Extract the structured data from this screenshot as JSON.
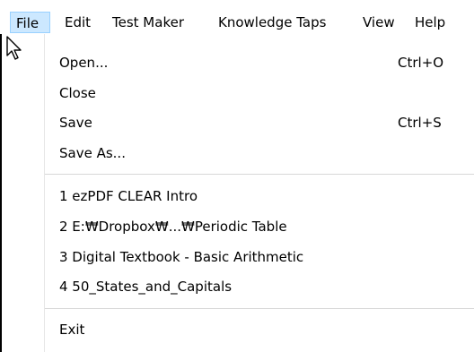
{
  "menubar": {
    "items": [
      {
        "label": "File"
      },
      {
        "label": "Edit"
      },
      {
        "label": "Test Maker"
      },
      {
        "label": "Knowledge Taps"
      },
      {
        "label": "View"
      },
      {
        "label": "Help"
      }
    ]
  },
  "file_menu": {
    "open": {
      "label": "Open...",
      "shortcut": "Ctrl+O"
    },
    "close": {
      "label": "Close"
    },
    "save": {
      "label": "Save",
      "shortcut": "Ctrl+S"
    },
    "save_as": {
      "label": "Save As..."
    },
    "recent": [
      {
        "label": "1 ezPDF CLEAR Intro"
      },
      {
        "label": "2 E:₩Dropbox₩...₩Periodic Table"
      },
      {
        "label": "3 Digital Textbook - Basic Arithmetic"
      },
      {
        "label": "4 50_States_and_Capitals"
      }
    ],
    "exit": {
      "label": "Exit"
    }
  },
  "colors": {
    "menubar_highlight": "#cce8ff",
    "menubar_highlight_border": "#99d1ff",
    "separator": "#d7d7d7"
  },
  "cursor_icon": "arrow-pointer-icon"
}
